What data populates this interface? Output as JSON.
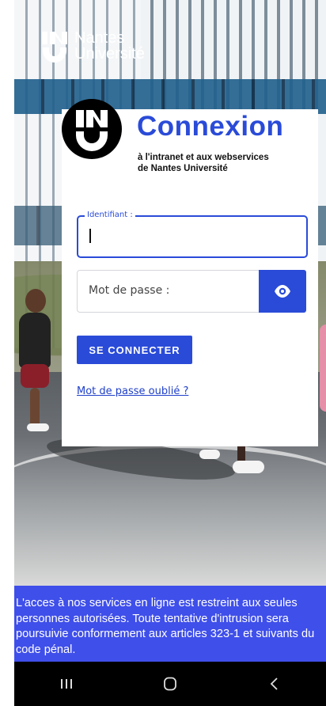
{
  "brand": {
    "line1": "Nantes",
    "line2": "Université"
  },
  "login": {
    "title": "Connexion",
    "subtitle_line1": "à l'intranet et aux webservices",
    "subtitle_line2": "de Nantes Université",
    "identifier_label": "Identifiant :",
    "identifier_value": "",
    "password_placeholder": "Mot de passe :",
    "submit_label": "SE CONNECTER",
    "forgot_label": "Mot de passe oublié ?"
  },
  "notice": {
    "text": "L'acces à nos services en ligne est restreint aux seules personnes autorisées. Toute tentative d'intrusion sera poursuivie conformement aux articles 323-1 et suivants du code pénal."
  },
  "navbar": {
    "items": [
      "recent-apps-icon",
      "home-icon",
      "back-icon"
    ]
  },
  "colors": {
    "accent": "#2a4bd8",
    "notice_bg": "#3f4fea",
    "navbar_bg": "#000000"
  }
}
